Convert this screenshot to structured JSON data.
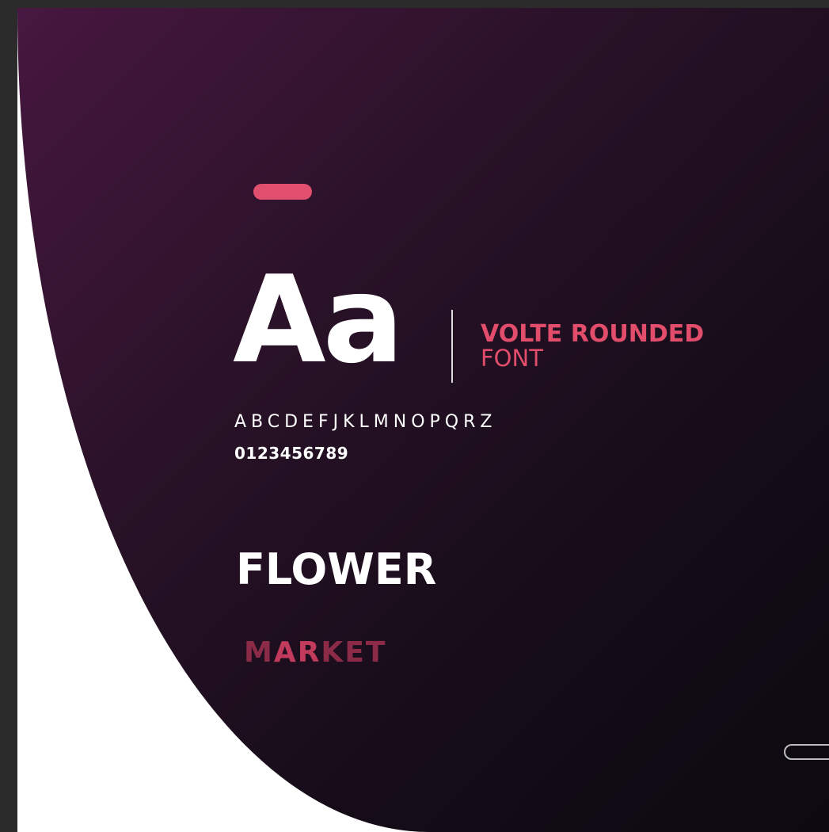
{
  "accent_color": "#e0506e",
  "background": {
    "frame": "#2b2b2b",
    "canvas": "#ffffff",
    "shape_gradient": [
      "#471740",
      "#2a1228",
      "#150c18",
      "#0c0a10"
    ]
  },
  "specimen": {
    "glyph_sample": "Aa",
    "font_name": "VOLTE ROUNDED",
    "font_label": "FONT",
    "alphabet": "ABCDEFJKLMNOPQRZ",
    "digits": "0123456789"
  },
  "example": {
    "title": "FLOWER",
    "subtitle_start": "M",
    "subtitle_mid": "AR",
    "subtitle_end": "KET"
  },
  "colors": {
    "title_text": "#ffffff",
    "font_name_text": "#e24d6b",
    "market_text": "#8c2b47",
    "market_mid_text": "#c23a5c"
  }
}
